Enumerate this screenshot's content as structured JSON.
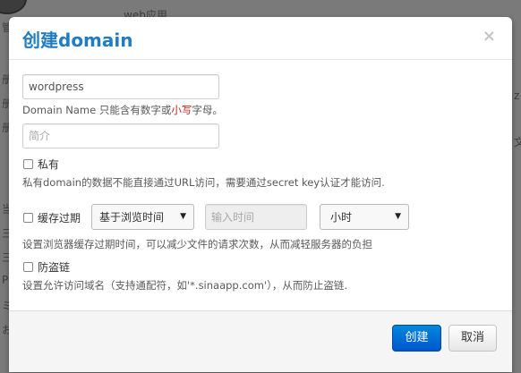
{
  "background": {
    "top_text": "web应用",
    "side_marks": [
      "管",
      "册",
      "册",
      "册",
      "当",
      "三",
      "三",
      "Pi",
      "ミ",
      "お",
      "z",
      "文"
    ]
  },
  "dialog": {
    "title": "创建domain",
    "close_symbol": "×",
    "domain_input": {
      "value": "wordpress",
      "placeholder": ""
    },
    "domain_help_prefix": "Domain Name 只能含有数字或",
    "domain_help_emph": "小写",
    "domain_help_suffix": "字母。",
    "description_input": {
      "value": "",
      "placeholder": "简介"
    },
    "private": {
      "label": "私有",
      "checked": false,
      "help": "私有domain的数据不能直接通过URL访问，需要通过secret key认证才能访问."
    },
    "cache": {
      "label": "缓存过期",
      "checked": false,
      "mode_select": "基于浏览时间",
      "time_input": {
        "value": "",
        "placeholder": "输入时间"
      },
      "unit_select": "小时",
      "help": "设置浏览器缓存过期时间，可以减少文件的请求次数，从而减轻服务器的负担"
    },
    "hotlink": {
      "label": "防盗链",
      "checked": false,
      "help": "设置允许访问域名（支持通配符，如'*.sinaapp.com'），从而防止盗链."
    },
    "buttons": {
      "create": "创建",
      "cancel": "取消"
    },
    "colors": {
      "title": "#1f7cc5",
      "primary": "#0066cc",
      "emphasis": "#c0261d"
    }
  }
}
